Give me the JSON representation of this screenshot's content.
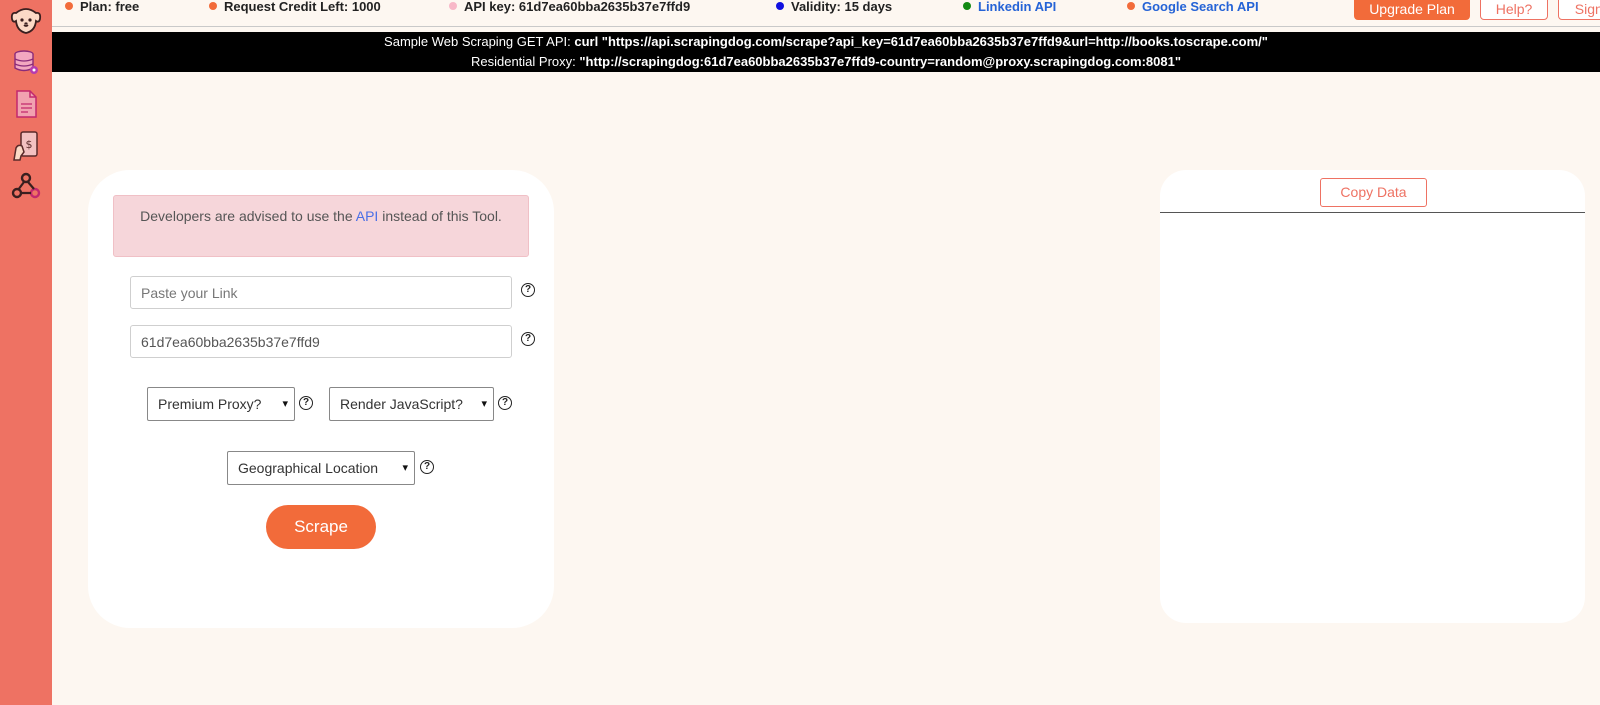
{
  "sidebar": {
    "items": [
      {
        "icon": "dog-logo-icon"
      },
      {
        "icon": "database-settings-icon"
      },
      {
        "icon": "document-icon"
      },
      {
        "icon": "billing-hand-icon"
      },
      {
        "icon": "webhook-icon"
      }
    ]
  },
  "topbar": {
    "plan": "Plan: free",
    "credits": "Request Credit Left: 1000",
    "api_key": "API key: 61d7ea60bba2635b37e7ffd9",
    "validity": "Validity: 15 days",
    "linkedin": "Linkedin API",
    "google": "Google Search API",
    "upgrade": "Upgrade Plan",
    "help": "Help?",
    "signout": "Sign Out",
    "dot_colors": {
      "plan": "#f26b3a",
      "credits": "#f26b3a",
      "api_key": "#f8b8c8",
      "validity": "#1010e0",
      "linkedin": "#138a13",
      "google": "#f26b3a"
    }
  },
  "banner": {
    "line1_label": "Sample Web Scraping GET API:",
    "line1_value": "curl \"https://api.scrapingdog.com/scrape?api_key=61d7ea60bba2635b37e7ffd9&url=http://books.toscrape.com/\"",
    "line2_label": "Residential Proxy:",
    "line2_value": "\"http://scrapingdog:61d7ea60bba2635b37e7ffd9-country=random@proxy.scrapingdog.com:8081\""
  },
  "form": {
    "alert_before": "Developers are advised to use the",
    "alert_link": "API",
    "alert_after": "instead of this Tool.",
    "link_placeholder": "Paste your Link",
    "api_key_value": "61d7ea60bba2635b37e7ffd9",
    "premium_proxy": "Premium Proxy?",
    "render_js": "Render JavaScript?",
    "geo_location": "Geographical Location",
    "scrape": "Scrape",
    "help_glyph": "?"
  },
  "output": {
    "copy": "Copy Data"
  },
  "colors": {
    "sidebar": "#ee7263",
    "accent": "#f26b3a",
    "page_bg": "#fdf7f1"
  }
}
